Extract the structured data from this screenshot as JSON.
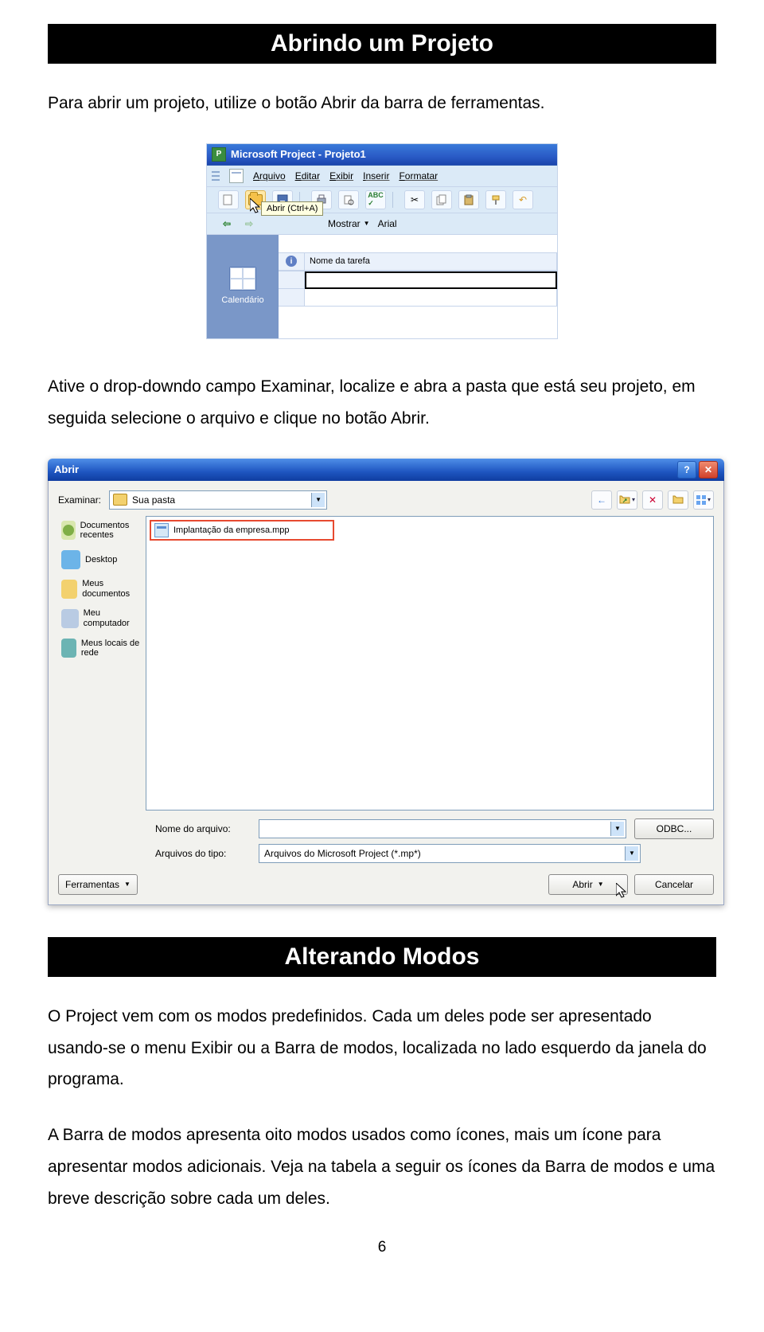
{
  "headings": {
    "h1": "Abrindo um Projeto",
    "h2": "Alterando Modos"
  },
  "paragraphs": {
    "p1": "Para abrir um projeto, utilize o botão Abrir da barra de ferramentas.",
    "p2": "Ative o drop-downdo campo Examinar, localize e abra a pasta que está seu projeto, em seguida selecione o arquivo e clique no botão Abrir.",
    "p3": "O Project vem com os modos predefinidos. Cada um deles pode ser apresentado usando-se o menu Exibir ou a Barra de modos, localizada no lado esquerdo da janela do programa.",
    "p4": "A Barra de modos apresenta oito modos usados como ícones, mais um ícone para apresentar modos adicionais. Veja na tabela a seguir os ícones da Barra de modos e uma breve descrição sobre cada um deles."
  },
  "page_number": "6",
  "fig1": {
    "title": "Microsoft Project - Projeto1",
    "menus": [
      "Arquivo",
      "Editar",
      "Exibir",
      "Inserir",
      "Formatar"
    ],
    "tooltip": "Abrir (Ctrl+A)",
    "mostrar": "Mostrar",
    "font": "Arial",
    "sidebar_label": "Calendário",
    "col_header": "Nome da tarefa"
  },
  "fig2": {
    "title": "Abrir",
    "examinar_label": "Examinar:",
    "examinar_value": "Sua pasta",
    "places": [
      "Documentos recentes",
      "Desktop",
      "Meus documentos",
      "Meu computador",
      "Meus locais de rede"
    ],
    "file_name": "Implantação da empresa.mpp",
    "nome_label": "Nome do arquivo:",
    "tipo_label": "Arquivos do tipo:",
    "tipo_value": "Arquivos do Microsoft Project (*.mp*)",
    "btn_ferramentas": "Ferramentas",
    "btn_odbc": "ODBC...",
    "btn_abrir": "Abrir",
    "btn_cancelar": "Cancelar"
  }
}
